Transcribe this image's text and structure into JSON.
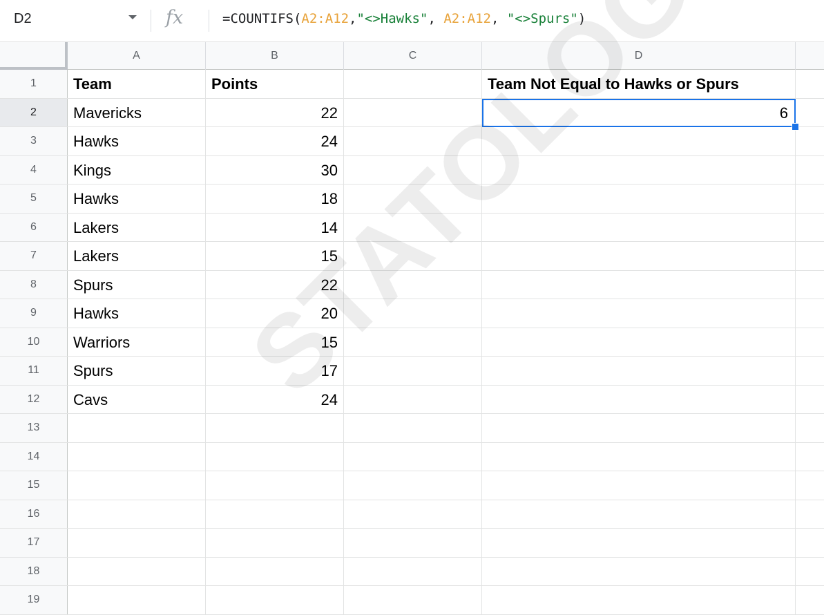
{
  "name_box": "D2",
  "formula": {
    "prefix": "=COUNTIFS(",
    "range1": "A2:A12",
    "comma1": ",",
    "crit1": "\"<>Hawks\"",
    "comma2": ", ",
    "range2": "A2:A12",
    "comma3": ", ",
    "crit2": "\"<>Spurs\"",
    "suffix": ")"
  },
  "columns": [
    "A",
    "B",
    "C",
    "D"
  ],
  "rows": [
    {
      "n": "1",
      "a": "Team",
      "b": "Points",
      "d": "Team Not Equal to Hawks or Spurs"
    },
    {
      "n": "2",
      "a": "Mavericks",
      "b": "22",
      "d": "6"
    },
    {
      "n": "3",
      "a": "Hawks",
      "b": "24",
      "d": ""
    },
    {
      "n": "4",
      "a": "Kings",
      "b": "30",
      "d": ""
    },
    {
      "n": "5",
      "a": "Hawks",
      "b": "18",
      "d": ""
    },
    {
      "n": "6",
      "a": "Lakers",
      "b": "14",
      "d": ""
    },
    {
      "n": "7",
      "a": "Lakers",
      "b": "15",
      "d": ""
    },
    {
      "n": "8",
      "a": "Spurs",
      "b": "22",
      "d": ""
    },
    {
      "n": "9",
      "a": "Hawks",
      "b": "20",
      "d": ""
    },
    {
      "n": "10",
      "a": "Warriors",
      "b": "15",
      "d": ""
    },
    {
      "n": "11",
      "a": "Spurs",
      "b": "17",
      "d": ""
    },
    {
      "n": "12",
      "a": "Cavs",
      "b": "24",
      "d": ""
    },
    {
      "n": "13",
      "a": "",
      "b": "",
      "d": ""
    },
    {
      "n": "14",
      "a": "",
      "b": "",
      "d": ""
    },
    {
      "n": "15",
      "a": "",
      "b": "",
      "d": ""
    },
    {
      "n": "16",
      "a": "",
      "b": "",
      "d": ""
    },
    {
      "n": "17",
      "a": "",
      "b": "",
      "d": ""
    },
    {
      "n": "18",
      "a": "",
      "b": "",
      "d": ""
    },
    {
      "n": "19",
      "a": "",
      "b": "",
      "d": ""
    }
  ],
  "watermark": "STATOLOGY.COM",
  "colors": {
    "selection": "#1a73e8",
    "range": "#e8a33b",
    "string": "#188038"
  },
  "icons": {
    "fx": "function-icon",
    "dropdown": "chevron-down-icon"
  },
  "fx_label": "fx"
}
